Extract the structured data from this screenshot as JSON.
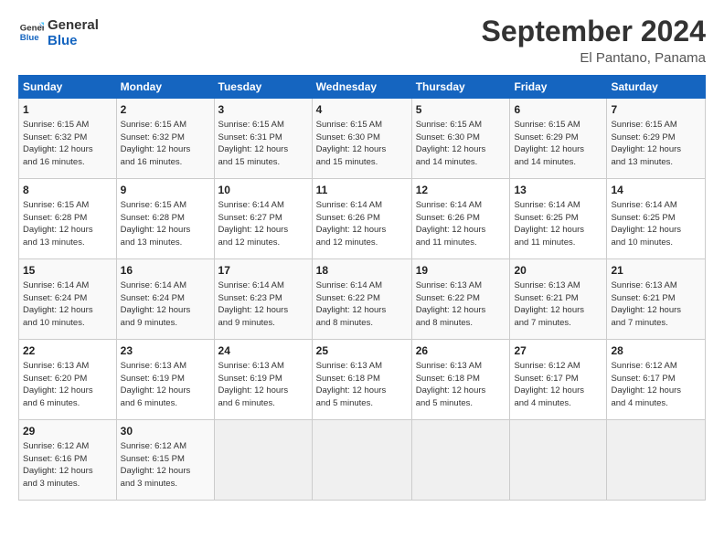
{
  "header": {
    "logo_line1": "General",
    "logo_line2": "Blue",
    "month": "September 2024",
    "location": "El Pantano, Panama"
  },
  "weekdays": [
    "Sunday",
    "Monday",
    "Tuesday",
    "Wednesday",
    "Thursday",
    "Friday",
    "Saturday"
  ],
  "weeks": [
    [
      {
        "num": "1",
        "lines": [
          "Sunrise: 6:15 AM",
          "Sunset: 6:32 PM",
          "Daylight: 12 hours",
          "and 16 minutes."
        ]
      },
      {
        "num": "2",
        "lines": [
          "Sunrise: 6:15 AM",
          "Sunset: 6:32 PM",
          "Daylight: 12 hours",
          "and 16 minutes."
        ]
      },
      {
        "num": "3",
        "lines": [
          "Sunrise: 6:15 AM",
          "Sunset: 6:31 PM",
          "Daylight: 12 hours",
          "and 15 minutes."
        ]
      },
      {
        "num": "4",
        "lines": [
          "Sunrise: 6:15 AM",
          "Sunset: 6:30 PM",
          "Daylight: 12 hours",
          "and 15 minutes."
        ]
      },
      {
        "num": "5",
        "lines": [
          "Sunrise: 6:15 AM",
          "Sunset: 6:30 PM",
          "Daylight: 12 hours",
          "and 14 minutes."
        ]
      },
      {
        "num": "6",
        "lines": [
          "Sunrise: 6:15 AM",
          "Sunset: 6:29 PM",
          "Daylight: 12 hours",
          "and 14 minutes."
        ]
      },
      {
        "num": "7",
        "lines": [
          "Sunrise: 6:15 AM",
          "Sunset: 6:29 PM",
          "Daylight: 12 hours",
          "and 13 minutes."
        ]
      }
    ],
    [
      {
        "num": "8",
        "lines": [
          "Sunrise: 6:15 AM",
          "Sunset: 6:28 PM",
          "Daylight: 12 hours",
          "and 13 minutes."
        ]
      },
      {
        "num": "9",
        "lines": [
          "Sunrise: 6:15 AM",
          "Sunset: 6:28 PM",
          "Daylight: 12 hours",
          "and 13 minutes."
        ]
      },
      {
        "num": "10",
        "lines": [
          "Sunrise: 6:14 AM",
          "Sunset: 6:27 PM",
          "Daylight: 12 hours",
          "and 12 minutes."
        ]
      },
      {
        "num": "11",
        "lines": [
          "Sunrise: 6:14 AM",
          "Sunset: 6:26 PM",
          "Daylight: 12 hours",
          "and 12 minutes."
        ]
      },
      {
        "num": "12",
        "lines": [
          "Sunrise: 6:14 AM",
          "Sunset: 6:26 PM",
          "Daylight: 12 hours",
          "and 11 minutes."
        ]
      },
      {
        "num": "13",
        "lines": [
          "Sunrise: 6:14 AM",
          "Sunset: 6:25 PM",
          "Daylight: 12 hours",
          "and 11 minutes."
        ]
      },
      {
        "num": "14",
        "lines": [
          "Sunrise: 6:14 AM",
          "Sunset: 6:25 PM",
          "Daylight: 12 hours",
          "and 10 minutes."
        ]
      }
    ],
    [
      {
        "num": "15",
        "lines": [
          "Sunrise: 6:14 AM",
          "Sunset: 6:24 PM",
          "Daylight: 12 hours",
          "and 10 minutes."
        ]
      },
      {
        "num": "16",
        "lines": [
          "Sunrise: 6:14 AM",
          "Sunset: 6:24 PM",
          "Daylight: 12 hours",
          "and 9 minutes."
        ]
      },
      {
        "num": "17",
        "lines": [
          "Sunrise: 6:14 AM",
          "Sunset: 6:23 PM",
          "Daylight: 12 hours",
          "and 9 minutes."
        ]
      },
      {
        "num": "18",
        "lines": [
          "Sunrise: 6:14 AM",
          "Sunset: 6:22 PM",
          "Daylight: 12 hours",
          "and 8 minutes."
        ]
      },
      {
        "num": "19",
        "lines": [
          "Sunrise: 6:13 AM",
          "Sunset: 6:22 PM",
          "Daylight: 12 hours",
          "and 8 minutes."
        ]
      },
      {
        "num": "20",
        "lines": [
          "Sunrise: 6:13 AM",
          "Sunset: 6:21 PM",
          "Daylight: 12 hours",
          "and 7 minutes."
        ]
      },
      {
        "num": "21",
        "lines": [
          "Sunrise: 6:13 AM",
          "Sunset: 6:21 PM",
          "Daylight: 12 hours",
          "and 7 minutes."
        ]
      }
    ],
    [
      {
        "num": "22",
        "lines": [
          "Sunrise: 6:13 AM",
          "Sunset: 6:20 PM",
          "Daylight: 12 hours",
          "and 6 minutes."
        ]
      },
      {
        "num": "23",
        "lines": [
          "Sunrise: 6:13 AM",
          "Sunset: 6:19 PM",
          "Daylight: 12 hours",
          "and 6 minutes."
        ]
      },
      {
        "num": "24",
        "lines": [
          "Sunrise: 6:13 AM",
          "Sunset: 6:19 PM",
          "Daylight: 12 hours",
          "and 6 minutes."
        ]
      },
      {
        "num": "25",
        "lines": [
          "Sunrise: 6:13 AM",
          "Sunset: 6:18 PM",
          "Daylight: 12 hours",
          "and 5 minutes."
        ]
      },
      {
        "num": "26",
        "lines": [
          "Sunrise: 6:13 AM",
          "Sunset: 6:18 PM",
          "Daylight: 12 hours",
          "and 5 minutes."
        ]
      },
      {
        "num": "27",
        "lines": [
          "Sunrise: 6:12 AM",
          "Sunset: 6:17 PM",
          "Daylight: 12 hours",
          "and 4 minutes."
        ]
      },
      {
        "num": "28",
        "lines": [
          "Sunrise: 6:12 AM",
          "Sunset: 6:17 PM",
          "Daylight: 12 hours",
          "and 4 minutes."
        ]
      }
    ],
    [
      {
        "num": "29",
        "lines": [
          "Sunrise: 6:12 AM",
          "Sunset: 6:16 PM",
          "Daylight: 12 hours",
          "and 3 minutes."
        ]
      },
      {
        "num": "30",
        "lines": [
          "Sunrise: 6:12 AM",
          "Sunset: 6:15 PM",
          "Daylight: 12 hours",
          "and 3 minutes."
        ]
      },
      {
        "num": "",
        "lines": []
      },
      {
        "num": "",
        "lines": []
      },
      {
        "num": "",
        "lines": []
      },
      {
        "num": "",
        "lines": []
      },
      {
        "num": "",
        "lines": []
      }
    ]
  ]
}
